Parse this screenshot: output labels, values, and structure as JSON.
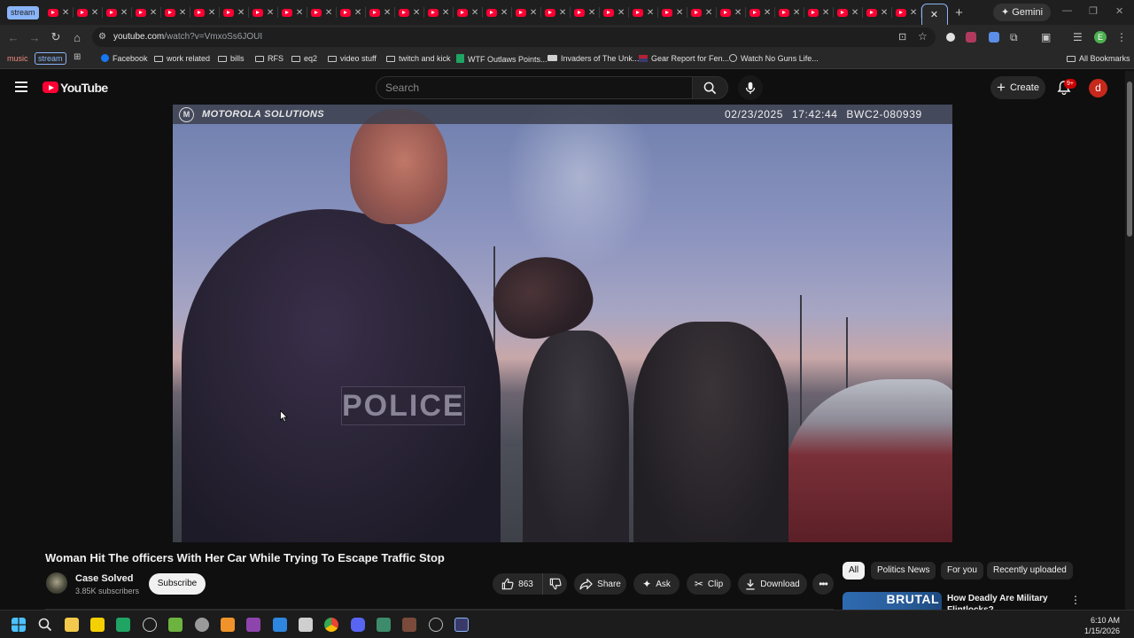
{
  "browser": {
    "first_tab_label": "stream",
    "active_tab_close": "✕",
    "new_tab": "+",
    "gemini_label": "Gemini",
    "url_host": "youtube.com",
    "url_path": "/watch?v=VmxoSs6JOUI",
    "bookmarks": [
      "music",
      "stream",
      "Facebook",
      "work related",
      "bills",
      "RFS",
      "eq2",
      "video stuff",
      "twitch and kick",
      "WTF Outlaws Points...",
      "Invaders of The Unk...",
      "Gear Report for Fen...",
      "Watch No Guns Life..."
    ],
    "all_bookmarks": "All Bookmarks"
  },
  "youtube": {
    "logo_text": "YouTube",
    "search_placeholder": "Search",
    "create_label": "Create",
    "notification_badge": "9+",
    "avatar_letter": "d"
  },
  "video_overlay": {
    "brand_logo": "M",
    "brand": "MOTOROLA SOLUTIONS",
    "stamp": "02/23/2025 17:42:44  BWC2-080939",
    "badge_text": "POLICE"
  },
  "video": {
    "title": "Woman Hit The officers With Her Car While Trying To Escape Traffic Stop",
    "channel": "Case Solved",
    "subscribers": "3.85K subscribers",
    "subscribe_label": "Subscribe",
    "likes": "863",
    "share_label": "Share",
    "ask_label": "Ask",
    "clip_label": "Clip",
    "download_label": "Download"
  },
  "sidebar": {
    "chips": [
      "All",
      "Politics News",
      "For you",
      "Recently uploaded"
    ],
    "recommendation": {
      "thumb_text": "BRUTAL",
      "title": "How Deadly Are Military Flintlocks?"
    }
  },
  "taskbar": {
    "time": "6:10 AM",
    "date": "1/15/2026"
  },
  "colors": {
    "yt_red": "#ff0033",
    "background": "#0f0f0f",
    "accent_blue": "#8ab4f8"
  }
}
